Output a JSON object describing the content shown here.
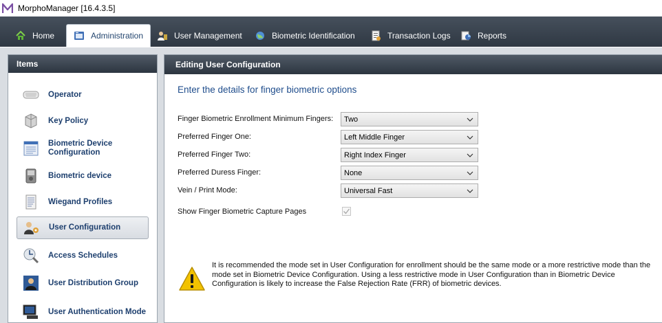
{
  "window": {
    "title": "MorphoManager [16.4.3.5]"
  },
  "tabs": [
    {
      "label": "Home",
      "icon": "home-icon"
    },
    {
      "label": "Administration",
      "icon": "administration-icon",
      "active": true
    },
    {
      "label": "User Management",
      "icon": "user-management-icon"
    },
    {
      "label": "Biometric Identification",
      "icon": "globe-icon"
    },
    {
      "label": "Transaction Logs",
      "icon": "transaction-logs-icon"
    },
    {
      "label": "Reports",
      "icon": "reports-icon"
    }
  ],
  "left_panel": {
    "header": "Items",
    "items": [
      {
        "label": "Operator",
        "icon": "keyboard-icon"
      },
      {
        "label": "Key Policy",
        "icon": "key-policy-icon"
      },
      {
        "label": "Biometric Device Configuration",
        "icon": "device-configuration-icon"
      },
      {
        "label": "Biometric device",
        "icon": "biometric-device-icon"
      },
      {
        "label": "Wiegand Profiles",
        "icon": "wiegand-profiles-icon"
      },
      {
        "label": "User Configuration",
        "icon": "user-configuration-icon",
        "selected": true
      },
      {
        "label": "Access Schedules",
        "icon": "access-schedules-icon"
      },
      {
        "label": "User Distribution Group",
        "icon": "user-distribution-icon"
      },
      {
        "label": "User Authentication Mode",
        "icon": "user-authentication-icon"
      }
    ]
  },
  "right_panel": {
    "header": "Editing User Configuration",
    "subtitle": "Enter the details for finger biometric options",
    "fields": [
      {
        "label": "Finger Biometric Enrollment Minimum Fingers:",
        "value": "Two"
      },
      {
        "label": "Preferred Finger One:",
        "value": "Left Middle Finger"
      },
      {
        "label": "Preferred Finger Two:",
        "value": "Right Index Finger"
      },
      {
        "label": "Preferred Duress Finger:",
        "value": "None"
      },
      {
        "label": "Vein / Print Mode:",
        "value": "Universal Fast"
      }
    ],
    "checkbox": {
      "label": "Show Finger Biometric Capture Pages",
      "checked": true
    },
    "warning": "It is recommended the mode set in User Configuration for enrollment should be the same mode or a more restrictive mode than the mode set in Biometric Device Configuration.  Using a less restrictive mode in User Configuration than in Biometric Device Configuration is likely to increase the False Rejection Rate (FRR) of biometric devices."
  },
  "colors": {
    "tab_bar": "#3a444f",
    "panel_header": "#3b4550",
    "nav_text": "#1d3f6e",
    "subtitle": "#1f4d8c",
    "warning_yellow": "#f2c200"
  }
}
